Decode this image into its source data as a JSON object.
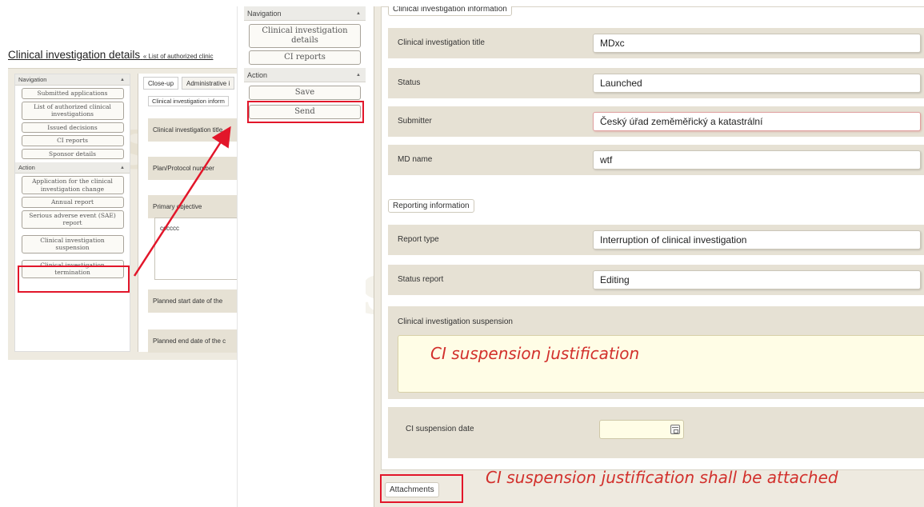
{
  "background_window": {
    "title": "Clinical investigation details",
    "breadcrumb": "« List of authorized clinic",
    "navigation": {
      "header": "Navigation",
      "items": [
        "Submitted applications",
        "List of authorized clinical investigations",
        "Issued decisions",
        "CI reports",
        "Sponsor details"
      ]
    },
    "action": {
      "header": "Action",
      "items": [
        "Application for the clinical investigation change",
        "Annual report",
        "Serious adverse event (SAE) report",
        "Clinical investigation suspension",
        "Clinical investigation termination"
      ]
    },
    "tabs": [
      "Close-up",
      "Administrative i"
    ],
    "fieldset_legend": "Clinical investigation inform",
    "rows": [
      "Clinical investigation title",
      "Plan/Protocol number",
      "Primary objective",
      "Planned start date of the",
      "Planned end date of the c"
    ],
    "objective_value": "cccccc"
  },
  "foreground_window": {
    "navigation": {
      "header": "Navigation",
      "items": [
        "Clinical investigation details",
        "CI reports"
      ]
    },
    "action": {
      "header": "Action",
      "save_label": "Save",
      "send_label": "Send"
    },
    "ci_info": {
      "legend": "Clinical investigation information",
      "rows": [
        {
          "label": "Clinical investigation title",
          "value": "MDxc"
        },
        {
          "label": "Status",
          "value": "Launched"
        },
        {
          "label": "Submitter",
          "value": "Český úřad zeměměřický a katastrální"
        },
        {
          "label": "MD name",
          "value": "wtf"
        }
      ]
    },
    "reporting": {
      "legend": "Reporting information",
      "rows": [
        {
          "label": "Report type",
          "value": "Interruption of clinical investigation"
        },
        {
          "label": "Status report",
          "value": "Editing"
        }
      ],
      "suspension_label": "Clinical investigation suspension",
      "suspension_date_label": "CI suspension date"
    },
    "attachments_legend": "Attachments"
  },
  "annotations": {
    "suspension_note": "CI suspension justification",
    "attachment_note": "CI suspension justification shall be attached",
    "highlight_color": "#e2162a"
  },
  "watermark": "Tes"
}
